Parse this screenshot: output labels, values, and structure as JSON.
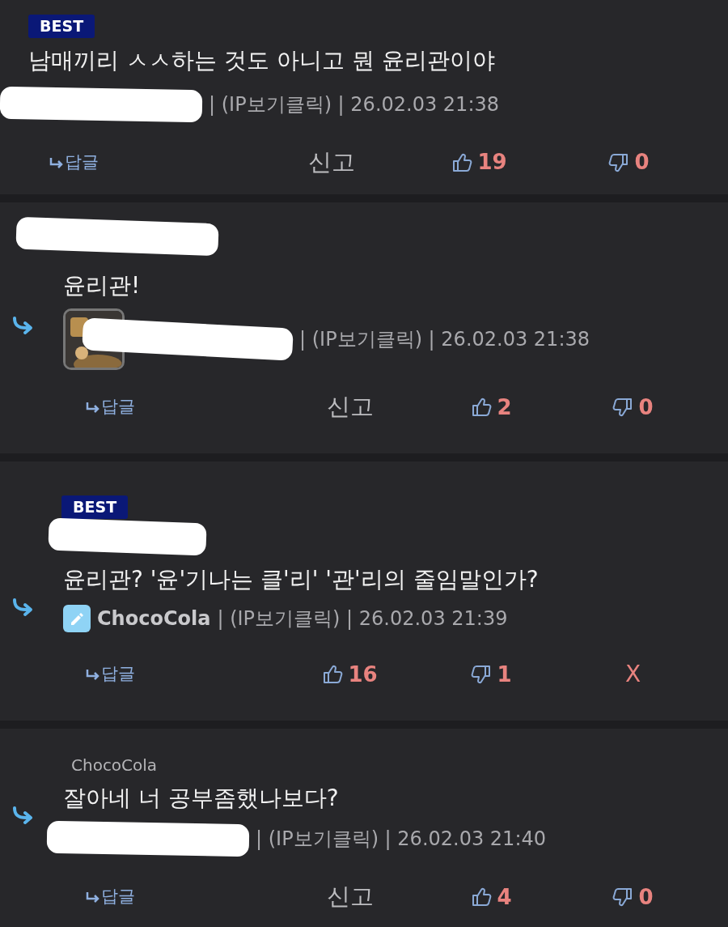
{
  "comments": [
    {
      "badge": "BEST",
      "is_reply": false,
      "top_redacted": false,
      "text": "남매끼리 ㅅㅅ하는 것도 아니고 뭔 윤리관이야",
      "author_redacted": true,
      "meta": "| (IP보기클릭) | 26.02.03 21:38",
      "actions": [
        {
          "kind": "reply",
          "label": "답글"
        },
        {
          "kind": "report",
          "label": "신고"
        },
        {
          "kind": "like",
          "label": "19"
        },
        {
          "kind": "dislike",
          "label": "0"
        }
      ]
    },
    {
      "is_reply": true,
      "top_redacted": true,
      "text": "윤리관!",
      "author_redacted": true,
      "meta": "| (IP보기클릭) | 26.02.03 21:38",
      "actions": [
        {
          "kind": "reply",
          "label": "답글"
        },
        {
          "kind": "report",
          "label": "신고"
        },
        {
          "kind": "like",
          "label": "2"
        },
        {
          "kind": "dislike",
          "label": "0"
        }
      ]
    },
    {
      "badge": "BEST",
      "is_reply": true,
      "top_redacted": true,
      "text": "윤리관? '윤'기나는 클'리' '관'리의 줄임말인가?",
      "avatar": {
        "kind": "pencil"
      },
      "author": "ChocoCola",
      "author_redacted": false,
      "meta": "| (IP보기클릭) | 26.02.03 21:39",
      "actions": [
        {
          "kind": "reply",
          "label": "답글"
        },
        {
          "kind": "like",
          "label": "16"
        },
        {
          "kind": "dislike",
          "label": "1"
        },
        {
          "kind": "delete",
          "label": "X"
        }
      ]
    },
    {
      "is_reply": true,
      "top_redacted": false,
      "quote_author": "ChocoCola",
      "text": "잘아네 너 공부좀했나보다?",
      "author_redacted": true,
      "meta": "| (IP보기클릭) | 26.02.03 21:40",
      "actions": [
        {
          "kind": "reply",
          "label": "답글"
        },
        {
          "kind": "report",
          "label": "신고"
        },
        {
          "kind": "like",
          "label": "4"
        },
        {
          "kind": "dislike",
          "label": "0"
        }
      ]
    }
  ]
}
